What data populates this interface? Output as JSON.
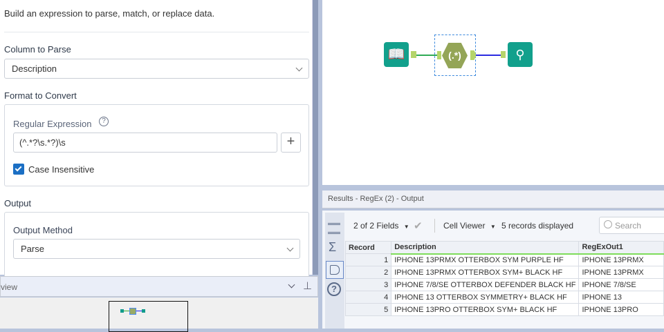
{
  "config": {
    "description": "Build an expression to parse, match, or replace data.",
    "column_to_parse_label": "Column to Parse",
    "column_to_parse_value": "Description",
    "format_label": "Format to Convert",
    "regex_label": "Regular Expression",
    "regex_value": "(^.*?\\s.*?)\\s",
    "case_insensitive_label": "Case Insensitive",
    "case_insensitive_checked": true,
    "output_label": "Output",
    "output_method_label": "Output Method",
    "output_method_value": "Parse"
  },
  "overview": {
    "title": "view"
  },
  "canvas": {
    "regex_tool_label": "(.*)"
  },
  "results": {
    "title": "Results - RegEx (2) - Output",
    "fields_label": "2 of 2 Fields",
    "viewer_label": "Cell Viewer",
    "records_label": "5 records displayed",
    "search_placeholder": "Search",
    "columns": [
      "Record",
      "Description",
      "RegExOut1"
    ],
    "rows": [
      [
        "1",
        "IPHONE 13PRMX OTTERBOX SYM PURPLE HF",
        "IPHONE 13PRMX"
      ],
      [
        "2",
        "IPHONE 13PRMX OTTERBOX SYM+ BLACK HF",
        "IPHONE 13PRMX"
      ],
      [
        "3",
        "IPHONE 7/8/SE OTTERBOX DEFENDER BLACK HF",
        "IPHONE 7/8/SE"
      ],
      [
        "4",
        "IPHONE 13 OTTERBOX SYMMETRY+ BLACK HF",
        "IPHONE 13"
      ],
      [
        "5",
        "IPHONE 13PRO OTTERBOX SYM+ BLACK HF",
        "IPHONE 13PRO"
      ]
    ]
  }
}
